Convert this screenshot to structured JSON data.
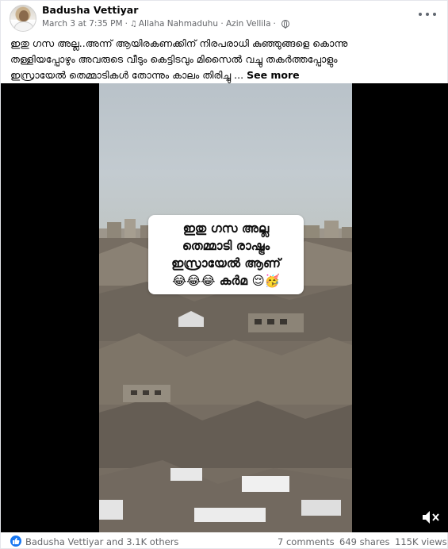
{
  "post": {
    "author": "Badusha Vettiyar",
    "timestamp": "March 3 at 7:35 PM",
    "audio": "Allaha Nahmaduhu · Azin Vellila",
    "privacy_icon": "globe-icon",
    "caption_lines": [
      "ഇതു ഗസ അല്ല..അന്ന് ആയിരകണക്കിന് നിരപരാധി കുഞ്ഞുങ്ങളെ കൊന്നു",
      "തള്ളിയപ്പോഴും അവരുടെ വീടും കെട്ടിടവും മിസൈൽ വച്ചു തകർത്തപ്പോളും",
      "ഇസ്രായേൽ തെമ്മാടികൾ തോന്നും കാലം തിരിച്ചു ..."
    ],
    "see_more": "See more"
  },
  "video": {
    "overlay_lines": [
      "ഇതു ഗസ അല്ല",
      "തെമ്മാടി രാഷ്ട്രം",
      "ഇസ്രായേൽ ആണ്",
      "😂😂😂 കർമ 😌🥳"
    ],
    "volume_icon": "volume-muted-icon"
  },
  "footer": {
    "reactions": "Badusha Vettiyar and 3.1K others",
    "reaction_icon": "like-icon",
    "comments": "7 comments",
    "shares": "649 shares",
    "views": "115K views"
  },
  "colors": {
    "text": "#050505",
    "secondary": "#65676b",
    "like_blue": "#1877f2",
    "video_bg": "#000000"
  }
}
